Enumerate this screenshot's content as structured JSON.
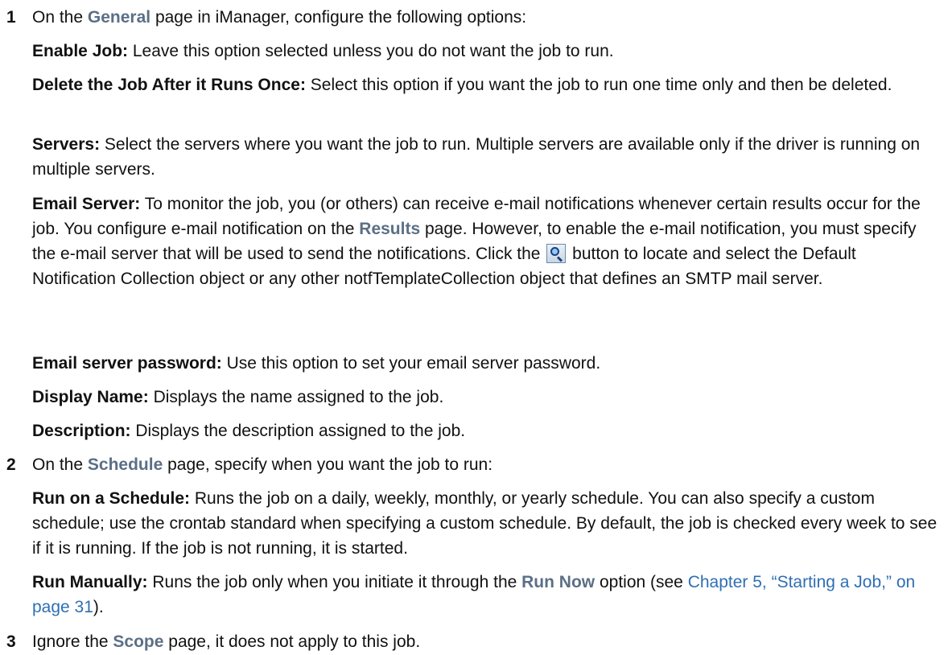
{
  "step1": {
    "num": "1",
    "pre": "On the ",
    "ui": "General",
    "post": " page in iManager, configure the following options:"
  },
  "enable_job": {
    "term": "Enable Job:",
    "desc": " Leave this option selected unless you do not want the job to run."
  },
  "delete_once": {
    "term": "Delete the Job After it Runs Once:",
    "desc": " Select this option if you want the job to run one time only and then be deleted."
  },
  "servers": {
    "term": "Servers:",
    "desc": " Select the servers where you want the job to run. Multiple servers are available only if the driver is running on multiple servers."
  },
  "email_server": {
    "term": "Email Server:",
    "desc1": " To monitor the job, you (or others) can receive e-mail notifications whenever certain results occur for the job. You configure e-mail notification on the ",
    "ui": "Results",
    "desc2": " page. However, to enable the e-mail notification, you must specify the e-mail server that will be used to send the notifications. Click the ",
    "icon": "search-icon",
    "desc3": " button to locate and select the Default Notification Collection object or any other notfTemplateCollection object that defines an SMTP mail server."
  },
  "email_password": {
    "term": "Email server password:",
    "desc": " Use this option to set your email server password."
  },
  "display_name": {
    "term": "Display Name:",
    "desc": " Displays the name assigned to the job."
  },
  "description": {
    "term": "Description:",
    "desc": " Displays the description assigned to the job."
  },
  "step2": {
    "num": "2",
    "pre": "On the ",
    "ui": "Schedule",
    "post": " page, specify when you want the job to run:"
  },
  "run_schedule": {
    "term": "Run on a Schedule:",
    "desc": " Runs the job on a daily, weekly, monthly, or yearly schedule. You can also specify a custom schedule; use the crontab standard when specifying a custom schedule. By default, the job is checked every week to see if it is running. If the job is not running, it is started."
  },
  "run_manually": {
    "term": "Run Manually:",
    "desc1": " Runs the job only when you initiate it through the ",
    "ui": "Run Now",
    "desc2": " option (see ",
    "link": "Chapter 5, “Starting a Job,” on page 31",
    "desc3": ")."
  },
  "step3": {
    "num": "3",
    "pre": "Ignore the ",
    "ui": "Scope",
    "post": " page, it does not apply to this job."
  },
  "colors": {
    "ui_reference": "#5b6f86",
    "link": "#2f6fb3",
    "text": "#111111"
  }
}
